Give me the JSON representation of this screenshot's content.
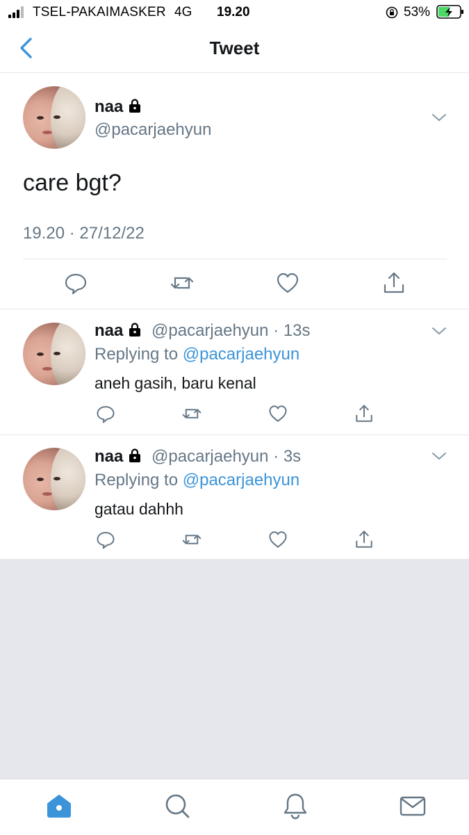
{
  "status_bar": {
    "carrier": "TSEL-PAKAIMASKER",
    "network": "4G",
    "time": "19.20",
    "battery_percent": "53%"
  },
  "header": {
    "title": "Tweet"
  },
  "main_tweet": {
    "name": "naa",
    "handle": "@pacarjaehyun",
    "text": "care bgt?",
    "timestamp": "19.20 · 27/12/22"
  },
  "replies": [
    {
      "name": "naa",
      "handle": "@pacarjaehyun",
      "age": "13s",
      "replying_prefix": "Replying to",
      "replying_to": "@pacarjaehyun",
      "text": "aneh gasih, baru kenal"
    },
    {
      "name": "naa",
      "handle": "@pacarjaehyun",
      "age": "3s",
      "replying_prefix": "Replying to",
      "replying_to": "@pacarjaehyun",
      "text": "gatau dahhh"
    }
  ],
  "icons": {
    "actions": [
      "reply-icon",
      "retweet-icon",
      "like-icon",
      "share-icon"
    ],
    "tabs": [
      "home-icon",
      "search-icon",
      "notifications-icon",
      "messages-icon"
    ]
  },
  "colors": {
    "accent": "#3b94d9",
    "secondary_text": "#657786",
    "background_empty": "#e6e7ec"
  }
}
